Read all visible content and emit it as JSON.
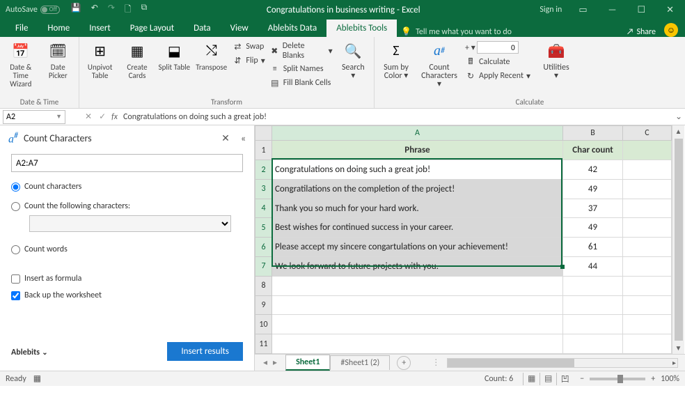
{
  "titlebar": {
    "autosave": "AutoSave",
    "autosave_state": "Off",
    "title": "Congratulations in business writing  -  Excel",
    "signin": "Sign in"
  },
  "tabs": {
    "file": "File",
    "home": "Home",
    "insert": "Insert",
    "pagelayout": "Page Layout",
    "data": "Data",
    "view": "View",
    "ablebitsdata": "Ablebits Data",
    "ablebitstools": "Ablebits Tools",
    "tellme": "Tell me what you want to do",
    "share": "Share"
  },
  "ribbon": {
    "datetime": {
      "datetimewiz": "Date & Time Wizard",
      "datepicker": "Date Picker",
      "group": "Date & Time"
    },
    "transform": {
      "unpivot": "Unpivot Table",
      "createcards": "Create Cards",
      "splittable": "Split Table",
      "transpose": "Transpose",
      "swap": "Swap",
      "flip": "Flip",
      "deleteblanks": "Delete Blanks",
      "splitnames": "Split Names",
      "fillblank": "Fill Blank Cells",
      "search": "Search",
      "group": "Transform"
    },
    "calculate": {
      "sumby": "Sum by Color",
      "countchars": "Count Characters",
      "calculate": "Calculate",
      "applyrecent": "Apply Recent",
      "utilities": "Utilities",
      "numval": "0",
      "group": "Calculate"
    }
  },
  "formulabar": {
    "namebox": "A2",
    "formula": "Congratulations on doing such a great job!"
  },
  "panel": {
    "title": "Count Characters",
    "range": "A2:A7",
    "opt_chars": "Count characters",
    "opt_following": "Count the following characters:",
    "opt_words": "Count words",
    "chk_formula": "Insert as formula",
    "chk_backup": "Back up the worksheet",
    "ablebits": "Ablebits",
    "insert": "Insert results"
  },
  "grid": {
    "cols": [
      "A",
      "B",
      "C"
    ],
    "headers": {
      "phrase": "Phrase",
      "count": "Char count"
    },
    "rows": [
      {
        "phrase": "Congratulations on doing such a great job!",
        "count": "42"
      },
      {
        "phrase": "Congratilations on the completion of the project!",
        "count": "49"
      },
      {
        "phrase": "Thank you so much for your hard work.",
        "count": "37"
      },
      {
        "phrase": "Best wishes for continued success in your career.",
        "count": "49"
      },
      {
        "phrase": "Please accept my sincere congartulations on your achievement!",
        "count": "61"
      },
      {
        "phrase": "We look forward to future projects with you.",
        "count": "44"
      }
    ]
  },
  "sheets": {
    "active": "Sheet1",
    "other": "#Sheet1 (2)"
  },
  "status": {
    "ready": "Ready",
    "count": "Count: 6",
    "zoom": "100%"
  }
}
